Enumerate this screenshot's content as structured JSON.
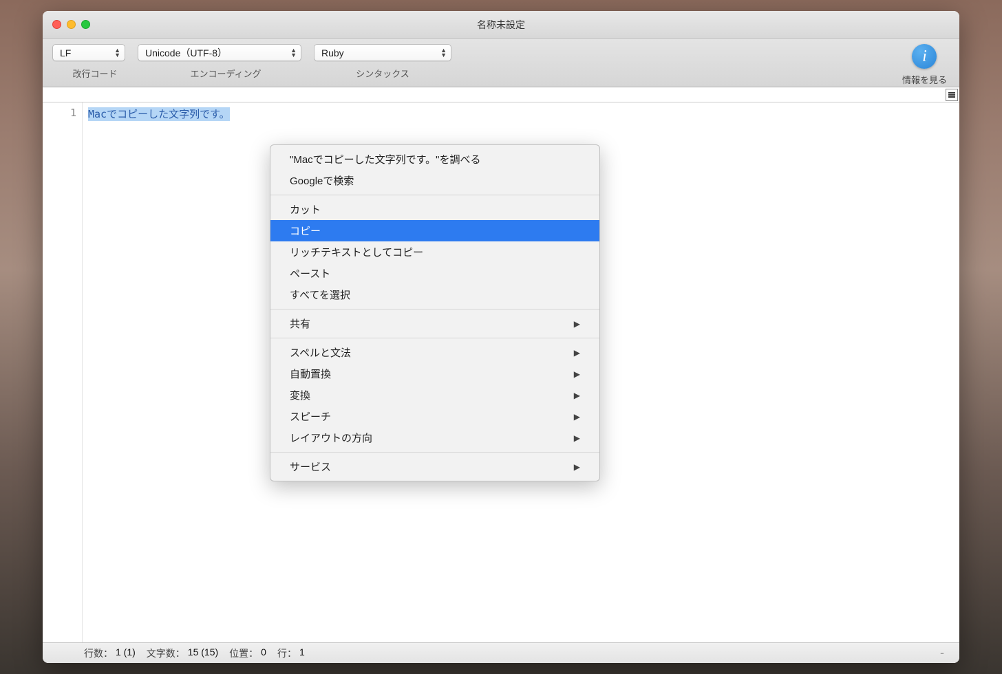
{
  "window": {
    "title": "名称未設定"
  },
  "toolbar": {
    "line_ending": "LF",
    "encoding": "Unicode（UTF-8）",
    "syntax": "Ruby",
    "labels": {
      "line_ending": "改行コード",
      "encoding": "エンコーディング",
      "syntax": "シンタックス"
    },
    "info_button": "情報を見る"
  },
  "editor": {
    "line_number": "1",
    "selected_text": "Macでコピーした文字列です。"
  },
  "context_menu": {
    "items": [
      {
        "label": "\"Macでコピーした文字列です。\"を調べる",
        "submenu": false,
        "highlighted": false
      },
      {
        "label": "Googleで検索",
        "submenu": false,
        "highlighted": false
      },
      {
        "sep": true
      },
      {
        "label": "カット",
        "submenu": false,
        "highlighted": false
      },
      {
        "label": "コピー",
        "submenu": false,
        "highlighted": true
      },
      {
        "label": "リッチテキストとしてコピー",
        "submenu": false,
        "highlighted": false
      },
      {
        "label": "ペースト",
        "submenu": false,
        "highlighted": false
      },
      {
        "label": "すべてを選択",
        "submenu": false,
        "highlighted": false
      },
      {
        "sep": true
      },
      {
        "label": "共有",
        "submenu": true,
        "highlighted": false
      },
      {
        "sep": true
      },
      {
        "label": "スペルと文法",
        "submenu": true,
        "highlighted": false
      },
      {
        "label": "自動置換",
        "submenu": true,
        "highlighted": false
      },
      {
        "label": "変換",
        "submenu": true,
        "highlighted": false
      },
      {
        "label": "スピーチ",
        "submenu": true,
        "highlighted": false
      },
      {
        "label": "レイアウトの方向",
        "submenu": true,
        "highlighted": false
      },
      {
        "sep": true
      },
      {
        "label": "サービス",
        "submenu": true,
        "highlighted": false
      }
    ]
  },
  "statusbar": {
    "lines_label": "行数：",
    "lines_value": "1 (1)",
    "chars_label": "文字数：",
    "chars_value": "15 (15)",
    "position_label": "位置：",
    "position_value": "0",
    "row_label": "行：",
    "row_value": "1"
  }
}
